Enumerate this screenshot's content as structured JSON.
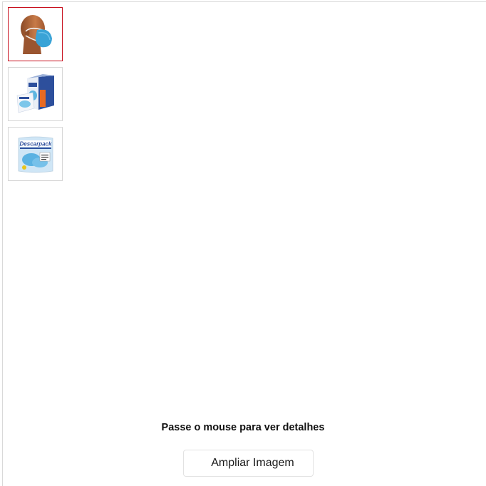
{
  "gallery": {
    "thumbnails": [
      {
        "icon": "mannequin-face-mask-icon",
        "selected": true
      },
      {
        "icon": "mask-box-package-icon",
        "selected": false
      },
      {
        "icon": "descarpack-bag-icon",
        "selected": false,
        "label": "Descarpack"
      }
    ]
  },
  "hint_text": "Passe o mouse para ver detalhes",
  "zoom_button_label": "Ampliar Imagem"
}
